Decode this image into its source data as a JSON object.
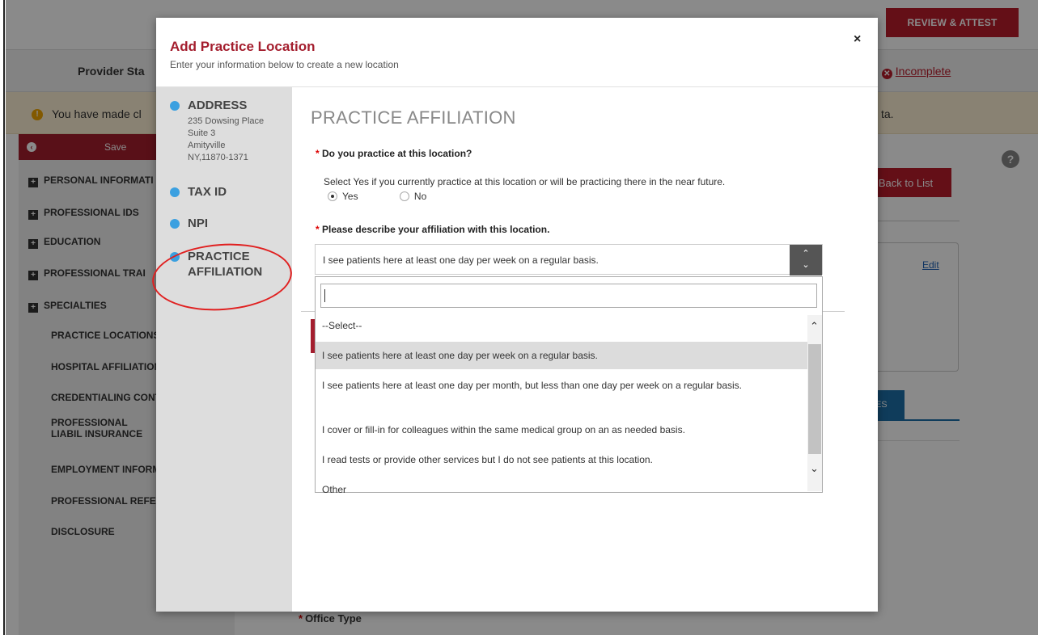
{
  "background": {
    "review_attest": "REVIEW & ATTEST",
    "provider_status": "Provider Sta",
    "status_prefix": ":",
    "status_value": "Incomplete",
    "warning": "You have made cl",
    "warning_tail": "ta.",
    "save": "Save",
    "sidebar_sections": [
      "PERSONAL INFORMATI",
      "PROFESSIONAL IDS",
      "EDUCATION",
      "PROFESSIONAL TRAI",
      "SPECIALTIES"
    ],
    "sidebar_subitems": [
      "PRACTICE LOCATIONS",
      "HOSPITAL AFFILIATION",
      "CREDENTIALING CONT",
      "PROFESSIONAL LIABIL INSURANCE",
      "EMPLOYMENT INFORM",
      "PROFESSIONAL REFER",
      "DISCLOSURE"
    ],
    "back_to_list": "Back to List",
    "edit": "Edit",
    "ces_tab": "CES",
    "office_type": "Office Type"
  },
  "modal": {
    "title": "Add Practice Location",
    "subtitle": "Enter your information below to create a new location",
    "close": "×",
    "steps": [
      {
        "name": "ADDRESS",
        "address": [
          "235 Dowsing Place",
          "Suite 3",
          "Amityville",
          "NY,11870-1371"
        ]
      },
      {
        "name": "TAX ID"
      },
      {
        "name": "NPI"
      },
      {
        "name": "PRACTICE AFFILIATION"
      }
    ],
    "section_title": "PRACTICE AFFILIATION",
    "question1": "Do you practice at this location?",
    "question1_help": "Select Yes if you currently practice at this location or will be practicing there in the near future.",
    "radio_yes": "Yes",
    "radio_no": "No",
    "radio_selected": "Yes",
    "question2": "Please describe your affiliation with this location.",
    "select_value": "I see patients here at least one day per week on a regular basis.",
    "dropdown_search_value": "",
    "dropdown_options": [
      "--Select--",
      "I see patients here at least one day per week on a regular basis.",
      "I see patients here at least one day per month, but less than one day per week on a regular basis.",
      "I cover or fill-in for colleagues within the same medical group on an as needed basis.",
      "I read tests or provide other services but I do not see patients at this location.",
      "Other"
    ],
    "highlighted_option": 1
  },
  "colors": {
    "brand_red": "#a41e2e",
    "step_dot": "#3ba0e0",
    "annotation_ellipse": "#e02020"
  }
}
